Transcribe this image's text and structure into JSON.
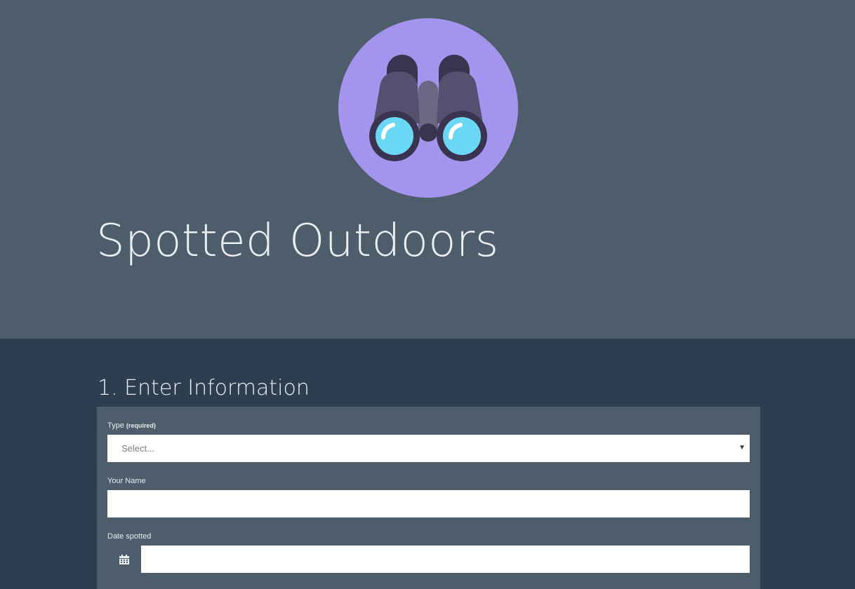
{
  "header": {
    "logo_icon": "binoculars-icon",
    "title": "Spotted Outdoors"
  },
  "form": {
    "section_title": "1. Enter Information",
    "type_field": {
      "label": "Type",
      "required_note": "(required)",
      "selected_value": "Select..."
    },
    "name_field": {
      "label": "Your Name",
      "value": ""
    },
    "date_field": {
      "label": "Date spotted",
      "icon": "calendar-icon",
      "value": ""
    }
  },
  "colors": {
    "hero_bg": "#4e5d6c",
    "page_bg": "#2c3e50",
    "logo_circle": "#a594ee",
    "lens": "#6ad8f4"
  }
}
